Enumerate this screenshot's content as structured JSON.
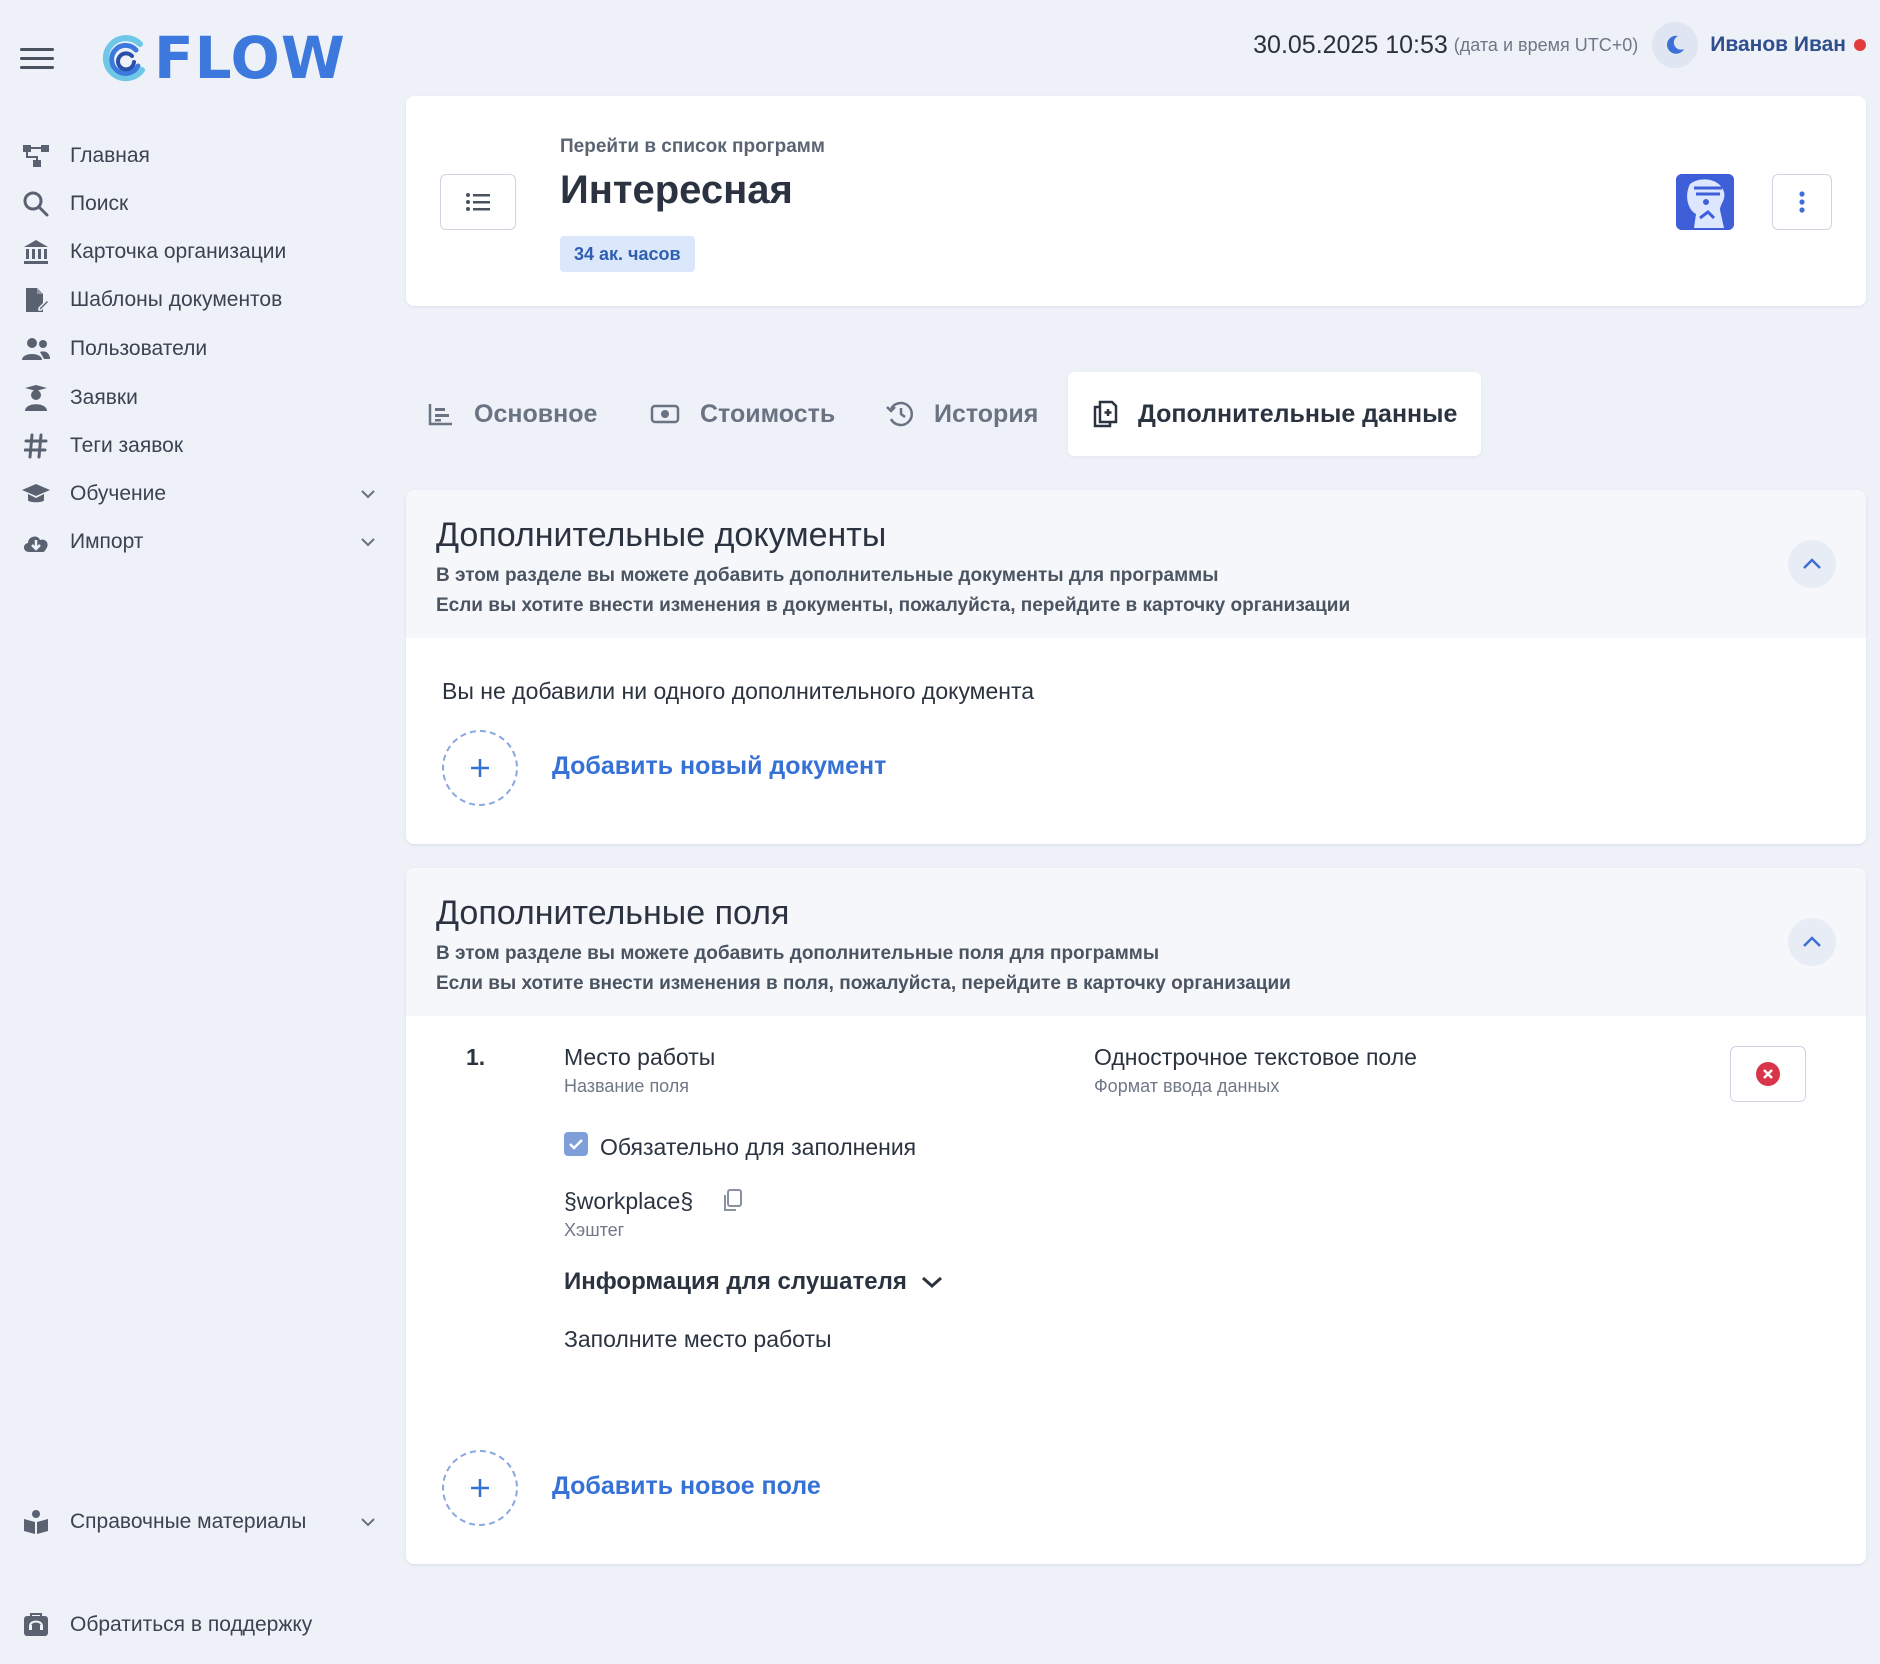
{
  "header": {
    "logo_text": "FLOW",
    "datetime": "30.05.2025 10:53",
    "datetime_note": "(дата и время UTC+0)",
    "user_name": "Иванов Иван",
    "status_color": "#e23b3b",
    "accent_color": "#3d79dd"
  },
  "sidebar": {
    "items": [
      {
        "label": "Главная",
        "icon": "sitemap-icon"
      },
      {
        "label": "Поиск",
        "icon": "search-icon"
      },
      {
        "label": "Карточка организации",
        "icon": "bank-icon"
      },
      {
        "label": "Шаблоны документов",
        "icon": "file-edit-icon"
      },
      {
        "label": "Пользователи",
        "icon": "users-icon"
      },
      {
        "label": "Заявки",
        "icon": "graduate-icon"
      },
      {
        "label": "Теги заявок",
        "icon": "hashtag-icon"
      },
      {
        "label": "Обучение",
        "icon": "graduation-cap-icon"
      },
      {
        "label": "Импорт",
        "icon": "cloud-download-icon"
      }
    ],
    "reference": "Справочные материалы",
    "support": "Обратиться в поддержку"
  },
  "program": {
    "breadcrumb": "Перейти в список программ",
    "title": "Интересная",
    "hours_badge": "34 ак. часов"
  },
  "tabs": [
    {
      "label": "Основное",
      "icon": "chart-icon"
    },
    {
      "label": "Стоимость",
      "icon": "money-icon"
    },
    {
      "label": "История",
      "icon": "history-icon"
    },
    {
      "label": "Дополнительные данные",
      "icon": "docs-add-icon",
      "active": true
    }
  ],
  "documents_section": {
    "title": "Дополнительные документы",
    "subtitle_1": "В этом разделе вы можете добавить дополнительные документы для программы",
    "subtitle_2": "Если вы хотите внести изменения в документы, пожалуйста, перейдите в карточку организации",
    "empty_text": "Вы не добавили ни одного дополнительного документа",
    "add_label": "Добавить новый документ"
  },
  "fields_section": {
    "title": "Дополнительные поля",
    "subtitle_1": "В этом разделе вы можете добавить дополнительные поля для программы",
    "subtitle_2": "Если вы хотите внести изменения в поля, пожалуйста, перейдите в карточку организации",
    "fields": [
      {
        "number": "1.",
        "name": "Место работы",
        "name_caption": "Название поля",
        "format": "Однострочное текстовое поле",
        "format_caption": "Формат ввода данных",
        "required_label": "Обязательно для заполнения",
        "required": true,
        "hashtag": "§workplace§",
        "hashtag_caption": "Хэштег",
        "info_label": "Информация для слушателя",
        "info_text": "Заполните место работы"
      }
    ],
    "add_label": "Добавить новое поле"
  }
}
